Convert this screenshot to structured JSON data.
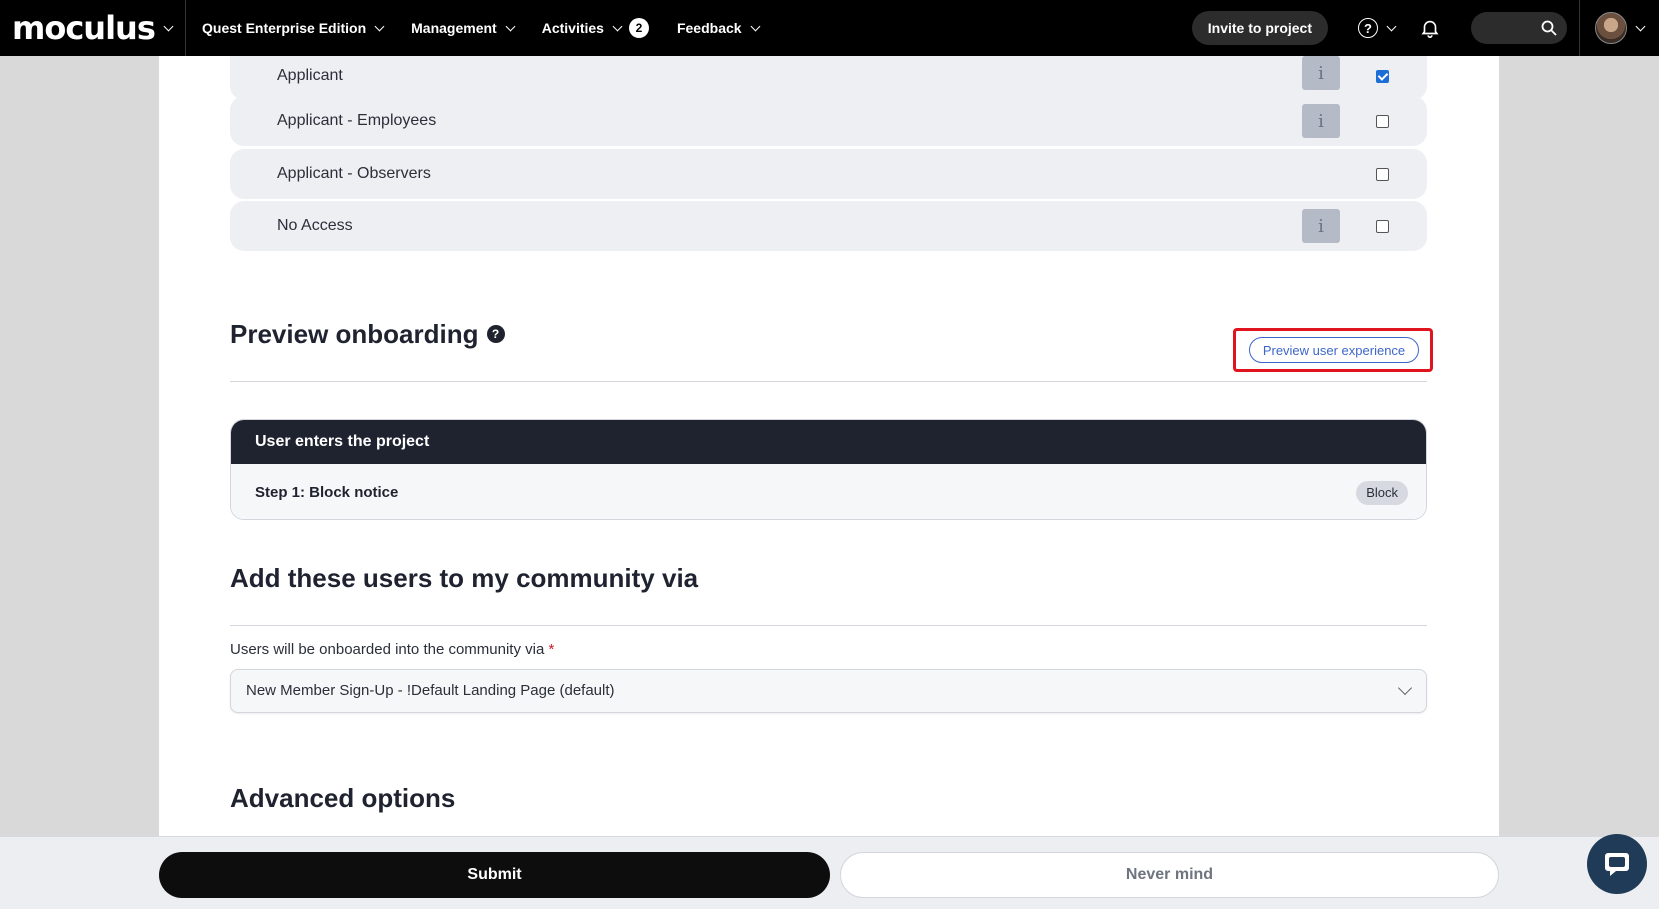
{
  "nav": {
    "logo": "moculus",
    "items": [
      {
        "label": "Quest Enterprise Edition"
      },
      {
        "label": "Management"
      },
      {
        "label": "Activities",
        "badge": "2"
      },
      {
        "label": "Feedback"
      }
    ],
    "invite_label": "Invite to project",
    "help_glyph": "?"
  },
  "roles": [
    {
      "label": "Applicant",
      "info": true,
      "checked": true
    },
    {
      "label": "Applicant - Employees",
      "info": true,
      "checked": false
    },
    {
      "label": "Applicant - Observers",
      "info": false,
      "checked": false
    },
    {
      "label": "No Access",
      "info": true,
      "checked": false
    }
  ],
  "info_glyph": "i",
  "preview": {
    "title": "Preview onboarding",
    "help_glyph": "?",
    "button_label": "Preview user experience",
    "flow_header": "User enters the project",
    "step_label": "Step 1: Block notice",
    "step_chip": "Block"
  },
  "community": {
    "title": "Add these users to my community via",
    "field_label": "Users will be onboarded into the community via",
    "required_mark": "*",
    "selected_value": "New Member Sign-Up - !Default Landing Page (default)"
  },
  "advanced": {
    "title": "Advanced options"
  },
  "footer": {
    "submit_label": "Submit",
    "cancel_label": "Never mind"
  },
  "colors": {
    "nav_bg": "#000000",
    "accent_blue": "#3e66c9",
    "highlight_red": "#e0141e",
    "checkbox_blue": "#1a6ed6"
  }
}
